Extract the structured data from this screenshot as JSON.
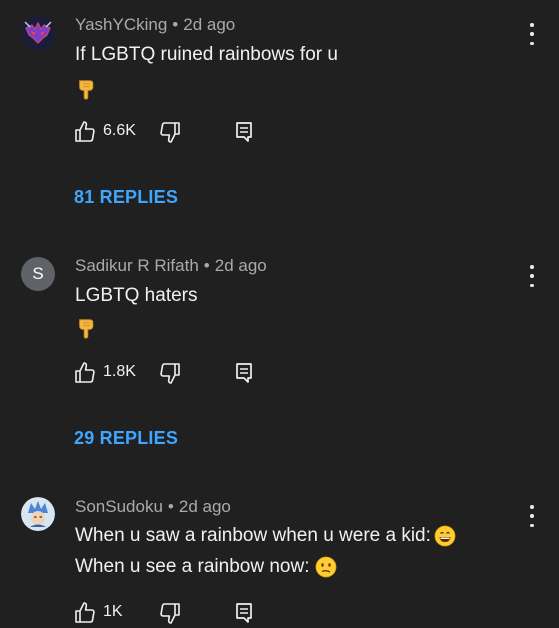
{
  "colors": {
    "background": "#202020",
    "text": "#f1f1f1",
    "meta_text": "#aaaaaa",
    "replies_link": "#3ea6ff"
  },
  "comments": [
    {
      "author": "YashYCking",
      "separator": "•",
      "time": "2d ago",
      "text_lines": [
        "If LGBTQ ruined rainbows for u"
      ],
      "emoji": "backhand-index-pointing-down",
      "likes": "6.6K",
      "replies": "81 REPLIES",
      "avatar": "dragon-logo-avatar"
    },
    {
      "author": "Sadikur R Rifath",
      "separator": "•",
      "time": "2d ago",
      "text_lines": [
        "LGBTQ haters"
      ],
      "emoji": "backhand-index-pointing-down",
      "likes": "1.8K",
      "replies": "29 REPLIES",
      "avatar_letter": "S"
    },
    {
      "author": "SonSudoku",
      "separator": "•",
      "time": "2d ago",
      "text_lines": [
        "When u saw a rainbow when u were a kid:",
        "When u see a rainbow now:"
      ],
      "line_emojis": [
        "grinning-face-with-smiling-eyes",
        "confused-face"
      ],
      "likes": "1K",
      "avatar": "anime-character-avatar"
    }
  ]
}
